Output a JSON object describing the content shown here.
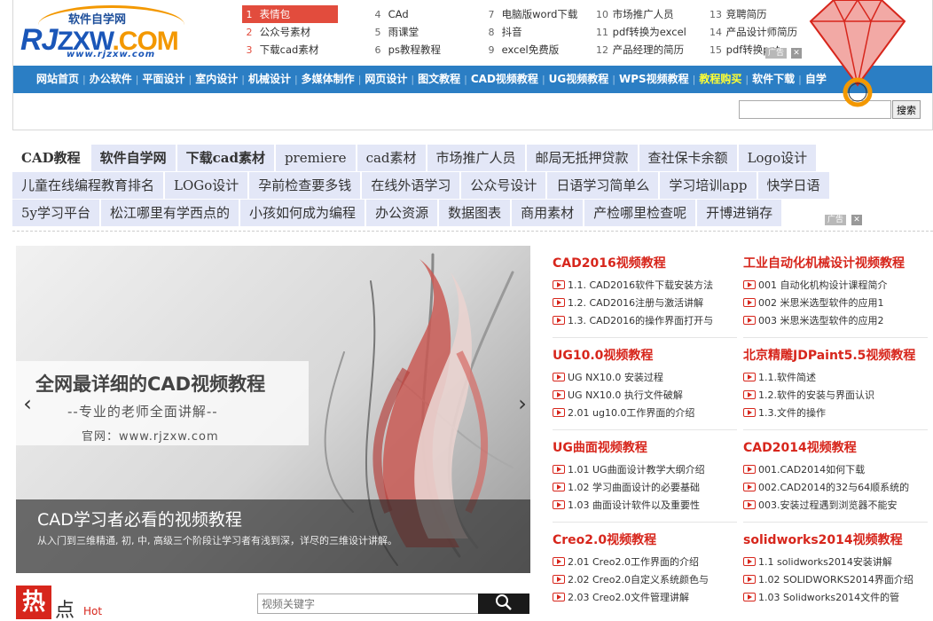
{
  "logo": {
    "cn": "软件自学网",
    "rj": "RJ",
    "zxw": "ZXW",
    "com": ".COM",
    "url": "www.rjzxw.com"
  },
  "top_links": [
    [
      {
        "num": "1",
        "text": "表情包"
      },
      {
        "num": "2",
        "text": "公众号素材"
      },
      {
        "num": "3",
        "text": "下载cad素材"
      }
    ],
    [
      {
        "num": "4",
        "text": "CAd"
      },
      {
        "num": "5",
        "text": "雨课堂"
      },
      {
        "num": "6",
        "text": "ps教程教程"
      }
    ],
    [
      {
        "num": "7",
        "text": "电脑版word下载"
      },
      {
        "num": "8",
        "text": "抖音"
      },
      {
        "num": "9",
        "text": "excel免费版"
      }
    ],
    [
      {
        "num": "10",
        "text": "市场推广人员"
      },
      {
        "num": "11",
        "text": "pdf转换为excel"
      },
      {
        "num": "12",
        "text": "产品经理的简历"
      }
    ],
    [
      {
        "num": "13",
        "text": "竞聘简历"
      },
      {
        "num": "14",
        "text": "产品设计师简历"
      },
      {
        "num": "15",
        "text": "pdf转换ppt"
      }
    ]
  ],
  "ad_label": "广告",
  "ad_close": "✕",
  "nav": [
    "网站首页",
    "办公软件",
    "平面设计",
    "室内设计",
    "机械设计",
    "多媒体制作",
    "网页设计",
    "图文教程",
    "CAD视频教程",
    "UG视频教程",
    "WPS视频教程",
    "教程购买",
    "软件下载",
    "自学"
  ],
  "nav_highlight_index": 11,
  "search": {
    "placeholder": "",
    "button": "搜索"
  },
  "keywords": [
    [
      {
        "text": "CAD教程",
        "style": "white bold"
      },
      {
        "text": "软件自学网",
        "style": "bold"
      },
      {
        "text": "下载cad素材",
        "style": "bold"
      },
      {
        "text": "premiere",
        "style": ""
      },
      {
        "text": "cad素材",
        "style": ""
      },
      {
        "text": "市场推广人员",
        "style": ""
      },
      {
        "text": "邮局无抵押贷款",
        "style": ""
      },
      {
        "text": "查社保卡余额",
        "style": ""
      },
      {
        "text": "Logo设计",
        "style": ""
      }
    ],
    [
      {
        "text": "儿童在线编程教育排名",
        "style": ""
      },
      {
        "text": "LOGo设计",
        "style": ""
      },
      {
        "text": "孕前检查要多钱",
        "style": ""
      },
      {
        "text": "在线外语学习",
        "style": ""
      },
      {
        "text": "公众号设计",
        "style": ""
      },
      {
        "text": "日语学习简单么",
        "style": ""
      },
      {
        "text": "学习培训app",
        "style": ""
      },
      {
        "text": "快学日语",
        "style": ""
      }
    ],
    [
      {
        "text": "5y学习平台",
        "style": ""
      },
      {
        "text": "松江哪里有学西点的",
        "style": ""
      },
      {
        "text": "小孩如何成为编程",
        "style": ""
      },
      {
        "text": "办公资源",
        "style": ""
      },
      {
        "text": "数据图表",
        "style": ""
      },
      {
        "text": "商用素材",
        "style": ""
      },
      {
        "text": "产检哪里检查呢",
        "style": ""
      },
      {
        "text": "开博进销存",
        "style": ""
      }
    ]
  ],
  "slider": {
    "headline": "全网最详细的CAD视频教程",
    "subline": "--专业的老师全面讲解--",
    "site": "官网：www.rjzxw.com",
    "caption_title": "CAD学习者必看的视频教程",
    "caption_desc": "从入门到三维精通, 初, 中, 高级三个阶段让学习者有浅到深，详尽的三维设计讲解。",
    "prev": "‹",
    "next": "›"
  },
  "courses": [
    {
      "title": "CAD2016视频教程",
      "items": [
        "1.1. CAD2016软件下载安装方法",
        "1.2. CAD2016注册与激活讲解",
        "1.3. CAD2016的操作界面打开与"
      ]
    },
    {
      "title": "工业自动化机械设计视频教程",
      "items": [
        "001 自动化机构设计课程简介",
        "002 米思米选型软件的应用1",
        "003 米思米选型软件的应用2"
      ]
    },
    {
      "title": "UG10.0视频教程",
      "items": [
        "UG NX10.0 安装过程",
        "UG NX10.0 执行文件破解",
        "2.01 ug10.0工作界面的介绍"
      ]
    },
    {
      "title": "北京精雕JDPaint5.5视频教程",
      "items": [
        "1.1.软件简述",
        "1.2.软件的安装与界面认识",
        "1.3.文件的操作"
      ]
    },
    {
      "title": "UG曲面视频教程",
      "items": [
        "1.01 UG曲面设计教学大纲介绍",
        "1.02 学习曲面设计的必要基础",
        "1.03 曲面设计软件以及重要性"
      ]
    },
    {
      "title": "CAD2014视频教程",
      "items": [
        "001.CAD2014如何下载",
        "002.CAD2014的32与64顺系统的",
        "003.安装过程遇到浏览器不能安"
      ]
    },
    {
      "title": "Creo2.0视频教程",
      "items": [
        "2.01 Creo2.0工作界面的介绍",
        "2.02 Creo2.0自定义系统颜色与",
        "2.03 Creo2.0文件管理讲解"
      ]
    },
    {
      "title": "solidworks2014视频教程",
      "items": [
        "1.1 solidworks2014安装讲解",
        "1.02 SOLIDWORKS2014界面介绍",
        "1.03 Solidworks2014文件的管"
      ]
    }
  ],
  "hot": {
    "re": "热",
    "dian": "点",
    "label": "Hot"
  },
  "video_search": {
    "placeholder": "视频关键字"
  },
  "colors": {
    "nav": "#2b7ec4",
    "accent": "#d7261c",
    "keyword_bg": "#e3e7f7",
    "orange": "#f39800"
  }
}
